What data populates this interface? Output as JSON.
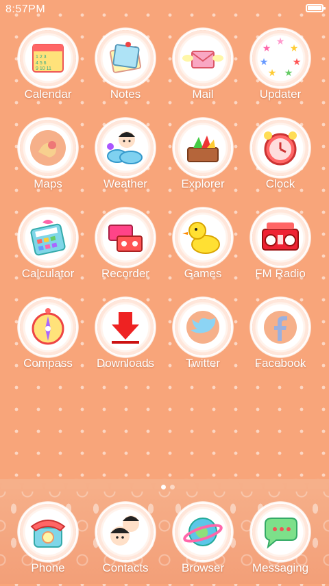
{
  "status_bar": {
    "time": "8:57PM",
    "battery_icon": "battery-icon"
  },
  "apps": [
    {
      "label": "Calendar",
      "icon": "calendar-icon"
    },
    {
      "label": "Notes",
      "icon": "notes-icon"
    },
    {
      "label": "Mail",
      "icon": "mail-icon"
    },
    {
      "label": "Updater",
      "icon": "updater-icon"
    },
    {
      "label": "Maps",
      "icon": "maps-icon"
    },
    {
      "label": "Weather",
      "icon": "weather-icon"
    },
    {
      "label": "Explorer",
      "icon": "explorer-icon"
    },
    {
      "label": "Clock",
      "icon": "clock-icon"
    },
    {
      "label": "Calculator",
      "icon": "calculator-icon"
    },
    {
      "label": "Recorder",
      "icon": "recorder-icon"
    },
    {
      "label": "Games",
      "icon": "games-icon"
    },
    {
      "label": "FM Radio",
      "icon": "fm-radio-icon"
    },
    {
      "label": "Compass",
      "icon": "compass-icon"
    },
    {
      "label": "Downloads",
      "icon": "downloads-icon"
    },
    {
      "label": "Twitter",
      "icon": "twitter-icon"
    },
    {
      "label": "Facebook",
      "icon": "facebook-icon"
    }
  ],
  "dock": [
    {
      "label": "Phone",
      "icon": "phone-icon"
    },
    {
      "label": "Contacts",
      "icon": "contacts-icon"
    },
    {
      "label": "Browser",
      "icon": "browser-icon"
    },
    {
      "label": "Messaging",
      "icon": "messaging-icon"
    }
  ],
  "page_indicator": {
    "pages": 2,
    "active": 1
  },
  "colors": {
    "background": "#f8a57a",
    "label": "#ffffff"
  }
}
